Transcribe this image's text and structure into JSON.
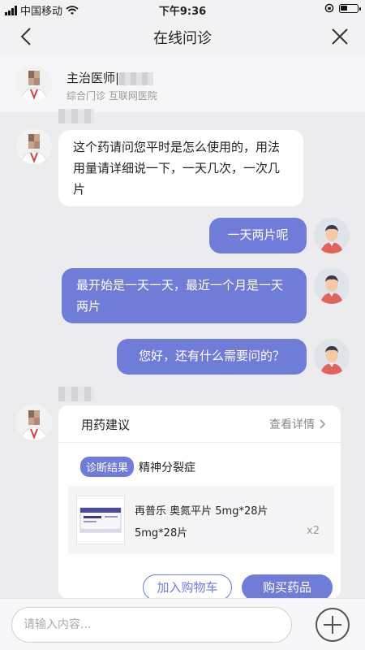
{
  "status_bar": {
    "carrier": "中国移动",
    "time": "下午9:36"
  },
  "nav": {
    "title": "在线问诊"
  },
  "doctor": {
    "title_label": "主治医师|",
    "subtitle": "综合门诊 互联网医院"
  },
  "messages": [
    {
      "side": "doctor",
      "text": "这个药请问您平时是怎么使用的，用法用量请详细说一下，一天几次，一次几片"
    },
    {
      "side": "user",
      "text": "一天两片呢"
    },
    {
      "side": "user",
      "text": "最开始是一天一天，最近一个月是一天两片"
    },
    {
      "side": "user",
      "text": "您好，还有什么需要问的？"
    }
  ],
  "card": {
    "title": "用药建议",
    "detail_link": "查看详情",
    "diagnosis_badge": "诊断结果",
    "diagnosis": "精神分裂症",
    "drug_name": "再普乐 奥氮平片 5mg*28片",
    "drug_spec": "5mg*28片",
    "drug_qty": "x2",
    "add_cart": "加入购物车",
    "buy": "购买药品"
  },
  "input": {
    "placeholder": "请输入内容..."
  },
  "colors": {
    "accent": "#6f7cd8",
    "background": "#ececef"
  }
}
